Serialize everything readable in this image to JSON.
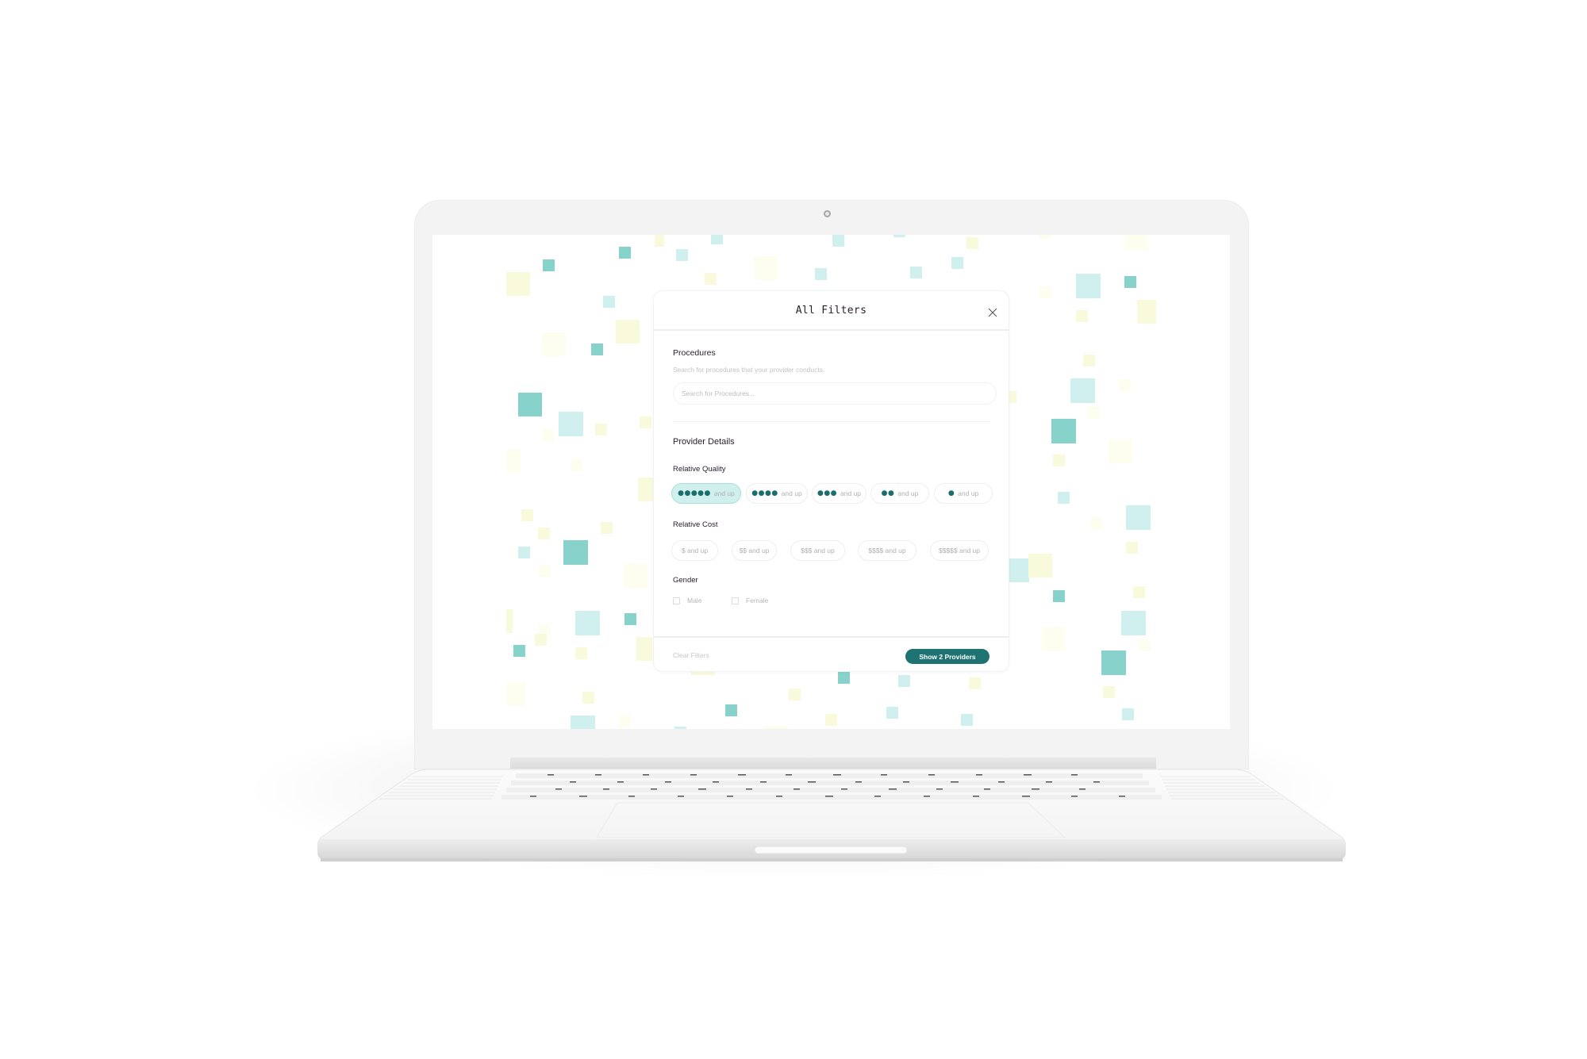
{
  "modal": {
    "title": "All Filters",
    "close_icon": "close-icon",
    "procedures": {
      "label": "Procedures",
      "help_text": "Search for procedures that your provider conducts.",
      "search_placeholder": "Search for Procedures...",
      "search_value": ""
    },
    "provider_details": {
      "label": "Provider Details",
      "relative_quality": {
        "label": "Relative Quality",
        "options": [
          {
            "dots": "●●●●●",
            "label": "and up",
            "selected": true
          },
          {
            "dots": "●●●●",
            "label": "and up",
            "selected": false
          },
          {
            "dots": "●●●",
            "label": "and up",
            "selected": false
          },
          {
            "dots": "●●",
            "label": "and up",
            "selected": false
          },
          {
            "dots": "●",
            "label": "and up",
            "selected": false
          }
        ]
      },
      "relative_cost": {
        "label": "Relative Cost",
        "options": [
          {
            "label": "$ and up",
            "selected": false
          },
          {
            "label": "$$ and up",
            "selected": false
          },
          {
            "label": "$$$ and up",
            "selected": false
          },
          {
            "label": "$$$$ and up",
            "selected": false
          },
          {
            "label": "$$$$$ and up",
            "selected": false
          }
        ]
      },
      "gender": {
        "label": "Gender",
        "options": [
          {
            "label": "Male",
            "checked": false
          },
          {
            "label": "Female",
            "checked": false
          }
        ]
      }
    },
    "footer": {
      "clear_label": "Clear Filters",
      "submit_label": "Show 2 Providers"
    }
  },
  "colors": {
    "accent": "#1f7473",
    "selected_chip_bg": "#d0f0ee",
    "square_teal": "#87d2cb",
    "square_cyan": "#cff0ee",
    "square_yellow": "#f9f9dc"
  }
}
